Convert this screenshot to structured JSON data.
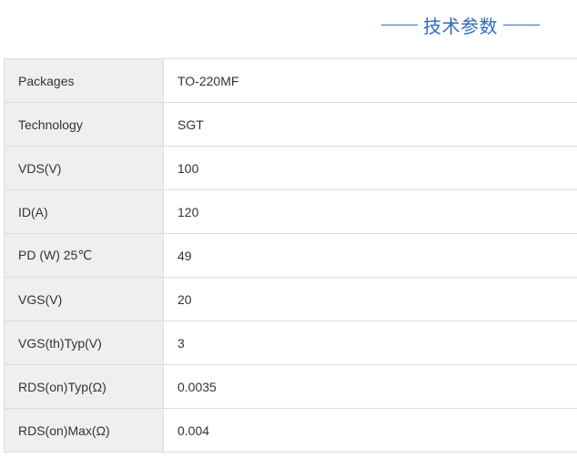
{
  "section": {
    "title": "技术参数"
  },
  "specs": [
    {
      "label": "Packages",
      "value": "TO-220MF"
    },
    {
      "label": "Technology",
      "value": "SGT"
    },
    {
      "label": "VDS(V)",
      "value": "100"
    },
    {
      "label": "ID(A)",
      "value": "120"
    },
    {
      "label": "PD (W) 25℃",
      "value": "49"
    },
    {
      "label": "VGS(V)",
      "value": "20"
    },
    {
      "label": "VGS(th)Typ(V)",
      "value": "3"
    },
    {
      "label": "RDS(on)Typ(Ω)",
      "value": "0.0035"
    },
    {
      "label": "RDS(on)Max(Ω)",
      "value": "0.004"
    }
  ],
  "colors": {
    "title_accent": "#2f6bbd",
    "label_bg": "#efefef",
    "border": "#dcdcdc"
  }
}
